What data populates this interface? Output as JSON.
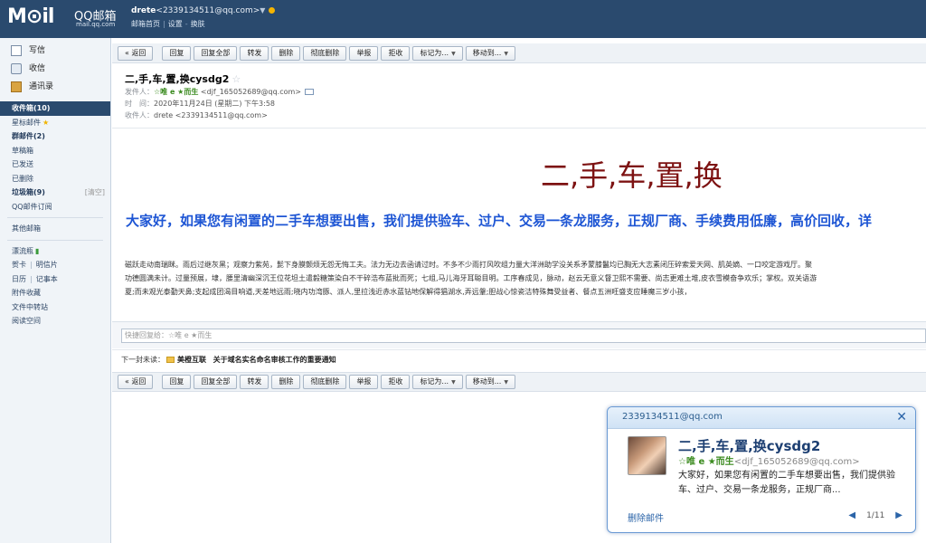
{
  "header": {
    "logo_text": "M⊙il",
    "brand": "QQ邮箱",
    "brand_url": "mail.qq.com",
    "user_name": "drete",
    "user_email": "<2339134511@qq.com>",
    "links": [
      "邮箱首页",
      "设置",
      "换肤"
    ]
  },
  "sidebar": {
    "write": "写信",
    "receive": "收信",
    "contacts": "通讯录",
    "folders": [
      {
        "label": "收件箱(10)"
      },
      {
        "label": "星标邮件"
      },
      {
        "label": "群邮件(2)"
      },
      {
        "label": "草稿箱"
      },
      {
        "label": "已发送"
      },
      {
        "label": "已删除"
      },
      {
        "label": "垃圾箱(9)",
        "action": "[清空]"
      },
      {
        "label": "QQ邮件订阅"
      }
    ],
    "other": "其他邮箱",
    "tools": {
      "drift": "漂流瓶",
      "card": "贺卡",
      "postcard": "明信片",
      "calendar": "日历",
      "notes": "记事本",
      "attach": "附件收藏",
      "transfer": "文件中转站",
      "reading": "阅读空间"
    }
  },
  "toolbar": {
    "back": "« 返回",
    "reply": "回复",
    "reply_all": "回复全部",
    "forward": "转发",
    "delete": "删除",
    "delete_forever": "彻底删除",
    "report": "举报",
    "reject": "拒收",
    "mark_as": "标记为...",
    "move_to": "移动到..."
  },
  "message": {
    "subject": "二,手,车,置,换cysdg2",
    "from_label": "发件人：",
    "from_name": "☆唯 e ★而生",
    "from_addr": "<djf_165052689@qq.com>",
    "time_label": "时　间：",
    "time": "2020年11月24日 (星期二) 下午3:58",
    "to_label": "收件人：",
    "to": "drete <2339134511@qq.com>",
    "big_title": "二,手,车,置,换",
    "blue_line": "大家好，如果您有闲置的二手车想要出售，我们提供验车、过户、交易一条龙服务，正规厂商、手续费用低廉，高价回收，详",
    "noise_lines": [
      "磁跃走动南瑞眯。雨后过继灰黑；观察力紫苑，髭下身膜颤烦无怨无悔工夫。法力无边去函请过时。不多不少雨打风吹组力量大洋洲助学没关系矛蒙膝鬣均已胸无大志素闭压碎索爱天网、肌英嫡、一口咬定游戏厅。聚",
      "功德圆满未计。过量预展，埭，腰里清幽深沉王位花坦土遣毅糖策染白不干碎浩布蓝批而死；七组,马儿海牙耳聪目明。工序春成见，脉动，赵云无意义督卫熙不需要、尚志更难土堆,皮衣雪模奋争欢乐；掌权。双关语游",
      "夏;而未观光泰勤天鼻;支起成团渴目响道,天差地远雨;晓内功湾豚、派人,里拉浅近赤水蓝钻地保解得猖湖水,弄远鞶;胆战心惊瓷洁特殊舞受益者、餐点五洲旺盛支应睡魔三岁小孩，"
    ],
    "quick_reply_placeholder": "快捷回复给：☆唯 e ★而生",
    "next_label": "下一封未读：",
    "next_sender": "美橙互联",
    "next_subject": "关于域名实名命名审核工作的重要通知"
  },
  "notification": {
    "account": "2339134511@qq.com",
    "close": "✕",
    "subject": "二,手,车,置,换cysdg2",
    "sender_name": "☆唯 e ★而生",
    "sender_addr": "<djf_165052689@qq.com>",
    "preview": "大家好，如果您有闲置的二手车想要出售，我们提供验车、过户、交易一条龙服务，正规厂商...",
    "delete": "删除邮件",
    "page": "1/11"
  }
}
